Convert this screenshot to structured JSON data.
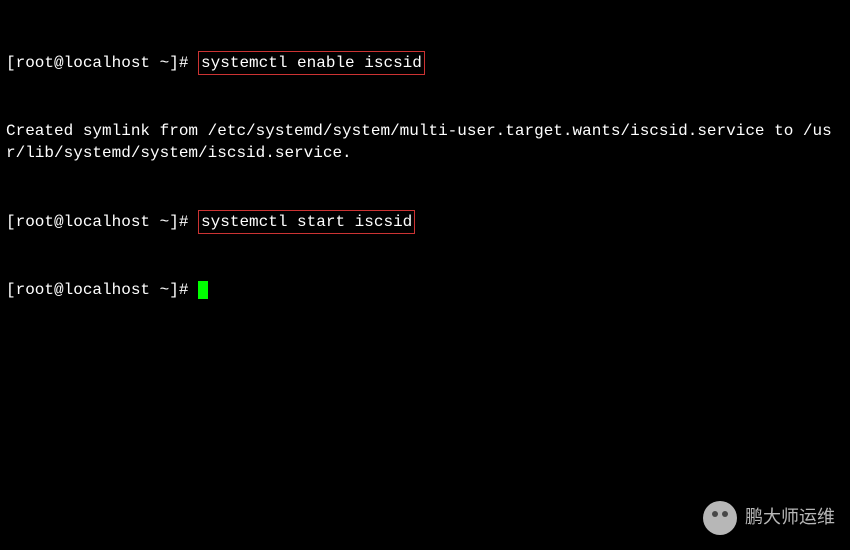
{
  "terminal": {
    "line1": {
      "prompt": "[root@localhost ~]# ",
      "command": "systemctl enable iscsid"
    },
    "line2_output": "Created symlink from /etc/systemd/system/multi-user.target.wants/iscsid.service to /usr/lib/systemd/system/iscsid.service.",
    "line3": {
      "prompt": "[root@localhost ~]# ",
      "command": "systemctl start iscsid"
    },
    "line4": {
      "prompt": "[root@localhost ~]# "
    }
  },
  "watermark": {
    "text": "鹏大师运维"
  }
}
